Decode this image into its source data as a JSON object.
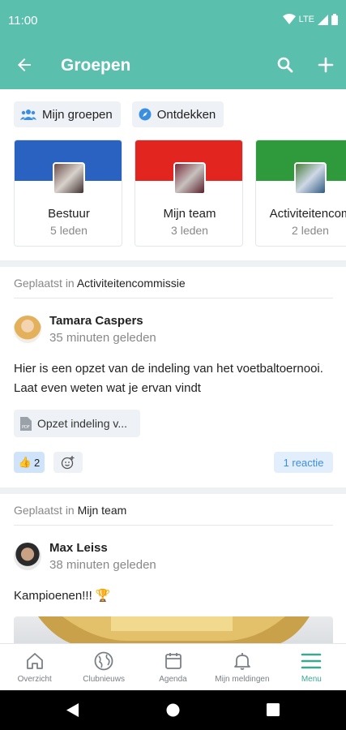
{
  "status": {
    "time": "11:00",
    "network": "LTE"
  },
  "appbar": {
    "title": "Groepen"
  },
  "chips": [
    {
      "label": "Mijn groepen"
    },
    {
      "label": "Ontdekken"
    }
  ],
  "groups": [
    {
      "name": "Bestuur",
      "count": "5 leden",
      "color": "#2a62c2"
    },
    {
      "name": "Mijn team",
      "count": "3 leden",
      "color": "#e2251f"
    },
    {
      "name": "Activiteitencom",
      "count": "2 leden",
      "color": "#2f9a3b"
    }
  ],
  "posts": [
    {
      "posted_prefix": "Geplaatst in",
      "group": "Activiteitencommissie",
      "author": "Tamara Caspers",
      "ago": "35 minuten geleden",
      "text": "Hier is een opzet van de indeling van het voetbaltoernooi. Laat even weten wat je ervan vindt",
      "attachment": "Opzet indeling v...",
      "likes": "2",
      "reactions_label": "1 reactie"
    },
    {
      "posted_prefix": "Geplaatst in",
      "group": "Mijn team",
      "author": "Max Leiss",
      "ago": "38 minuten geleden",
      "text": "Kampioenen!!! 🏆"
    }
  ],
  "nav": [
    {
      "label": "Overzicht"
    },
    {
      "label": "Clubnieuws"
    },
    {
      "label": "Agenda"
    },
    {
      "label": "Mijn meldingen"
    },
    {
      "label": "Menu"
    }
  ],
  "colors": {
    "primary": "#5bbfae",
    "active": "#3aa893",
    "link": "#3b8fe0"
  }
}
